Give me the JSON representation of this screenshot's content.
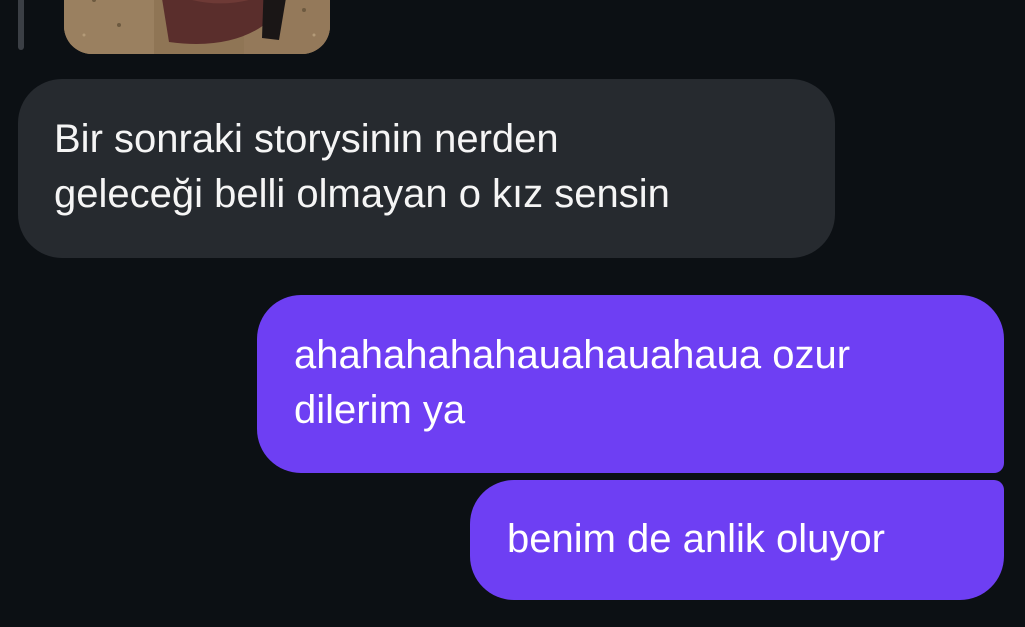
{
  "messages": [
    {
      "direction": "incoming",
      "lines": [
        "Bir sonraki storysinin nerden",
        "geleceği belli olmayan o kız sensin"
      ]
    },
    {
      "direction": "outgoing",
      "lines": [
        "ahahahahahauahauahaua ozur",
        "dilerim ya"
      ]
    },
    {
      "direction": "outgoing",
      "lines": [
        "benim de anlik oluyor"
      ]
    }
  ],
  "colors": {
    "background": "#0c1014",
    "incoming_bubble": "#262a2f",
    "outgoing_bubble": "#6e3ff3",
    "text": "#ffffff"
  },
  "icons": {
    "story_reply": "story-thumbnail-image"
  }
}
